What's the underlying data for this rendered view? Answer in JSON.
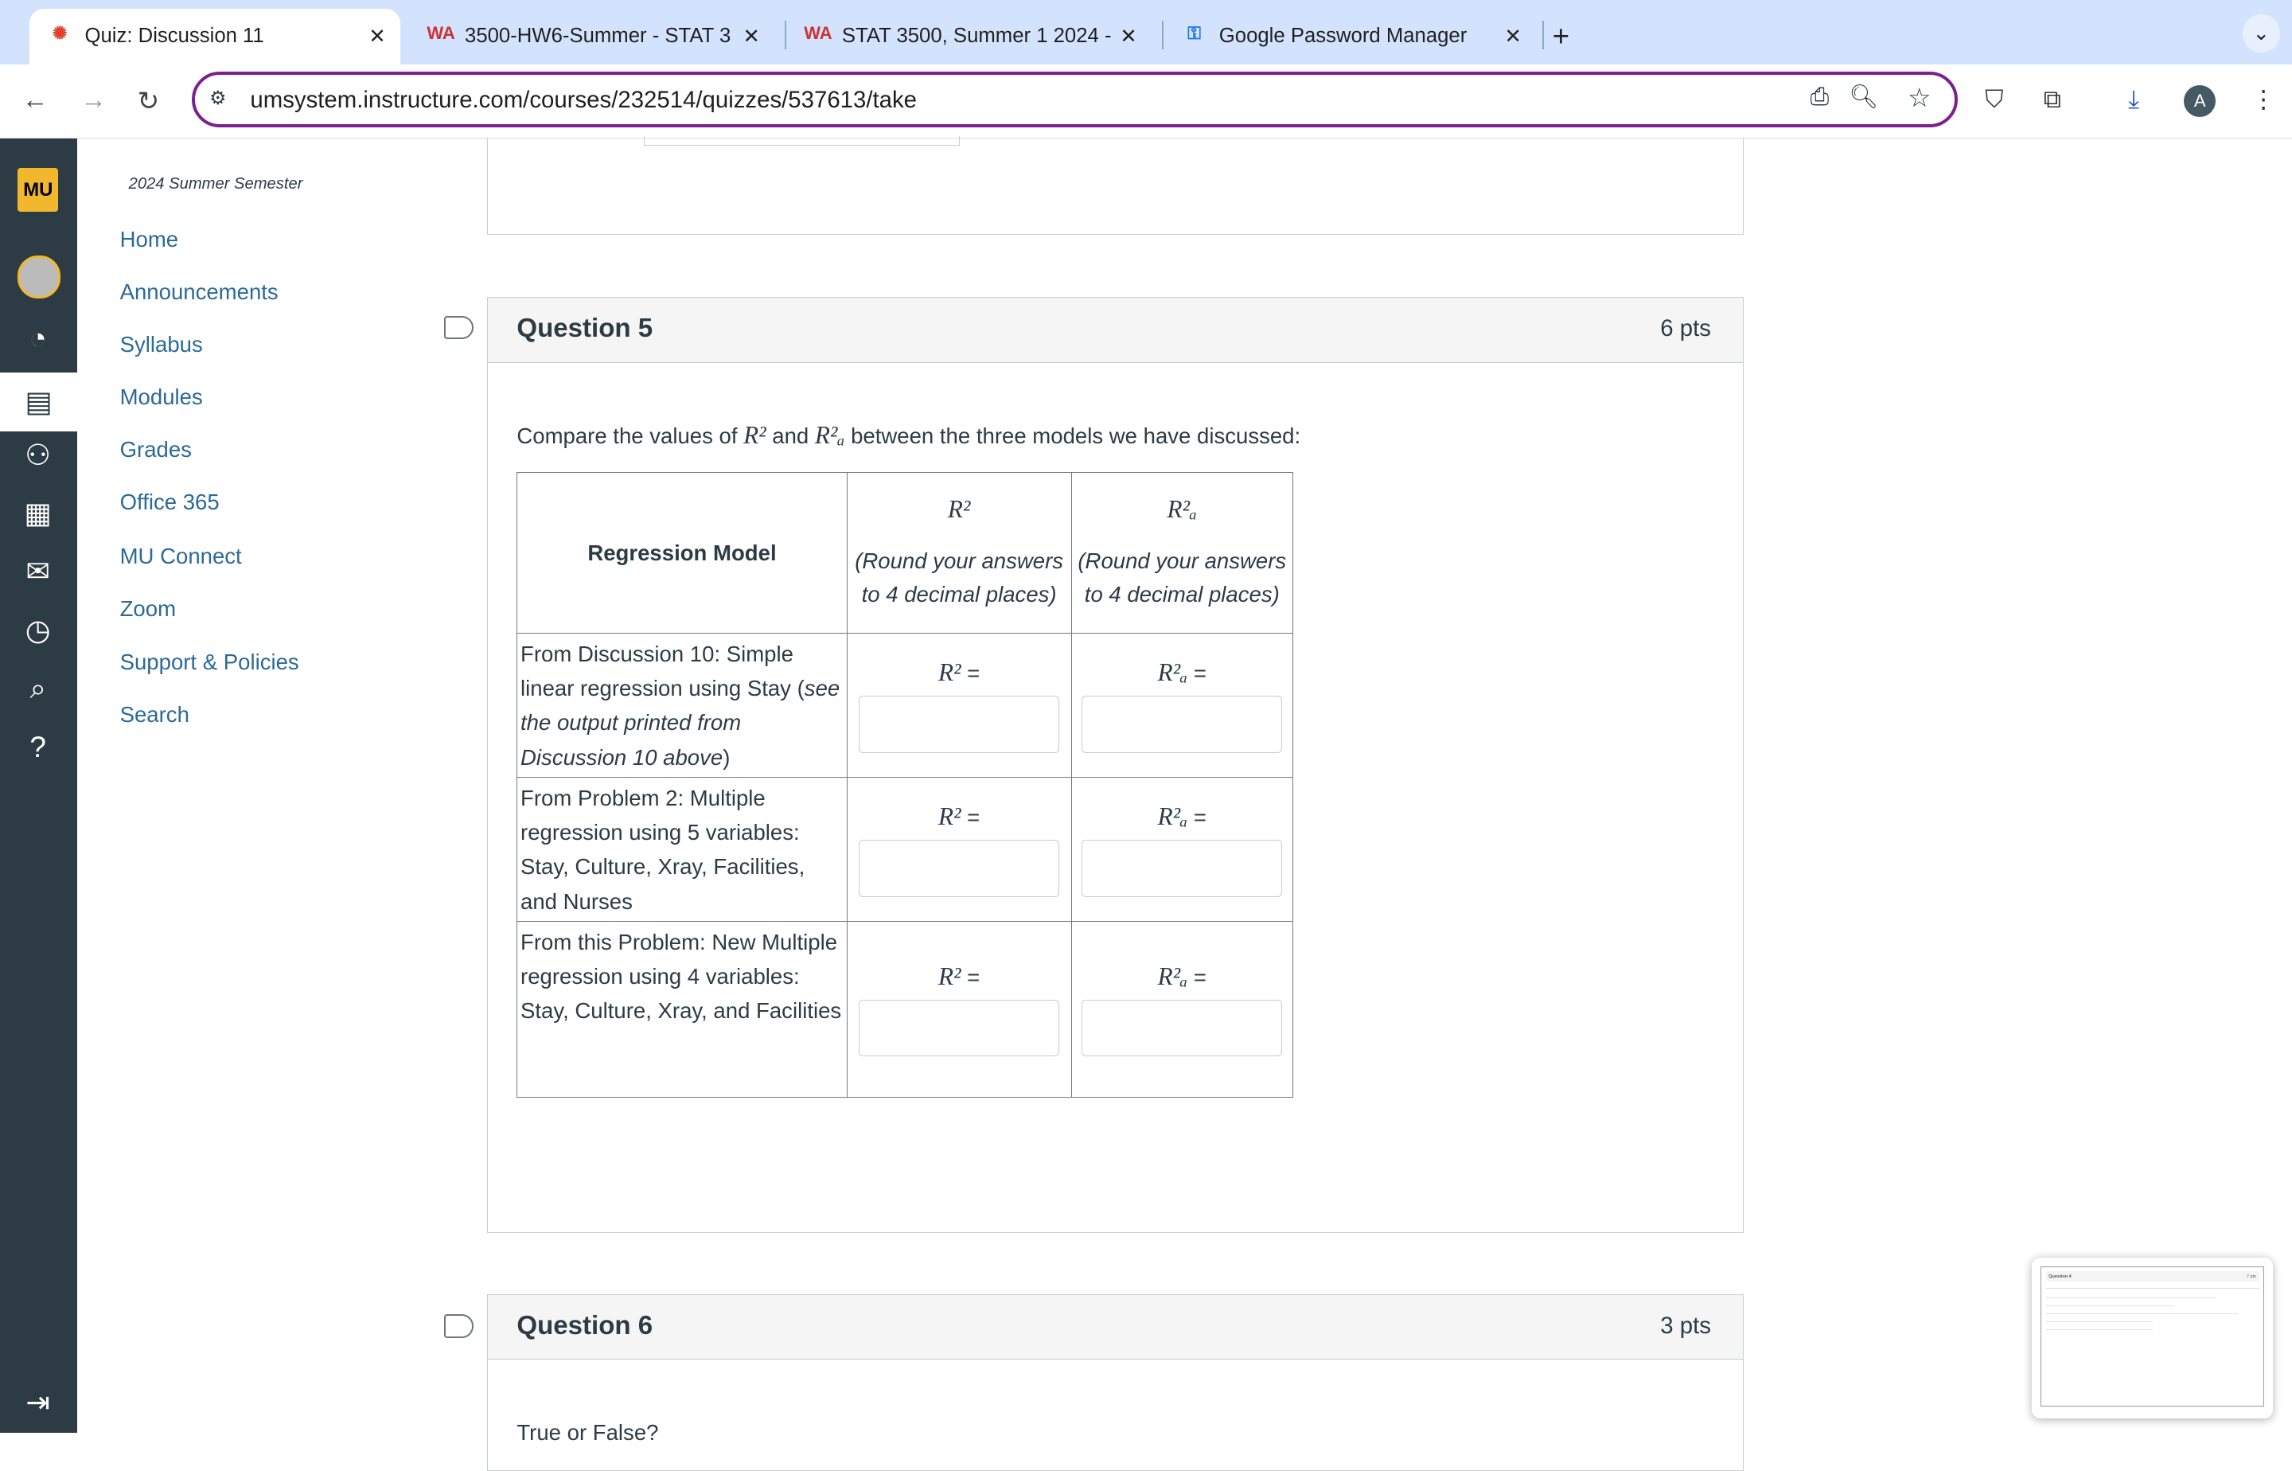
{
  "browser": {
    "tabs": [
      {
        "title": "Quiz: Discussion 11",
        "icon": "canvas-icon",
        "active": true
      },
      {
        "title": "3500-HW6-Summer - STAT 3",
        "icon": "webassign-icon"
      },
      {
        "title": "STAT 3500, Summer 1 2024 -",
        "icon": "webassign-icon"
      },
      {
        "title": "Google Password Manager",
        "icon": "key-icon"
      }
    ],
    "url": "umsystem.instructure.com/courses/232514/quizzes/537613/take",
    "profile_initial": "A"
  },
  "course_nav": {
    "semester": "2024 Summer Semester",
    "items": [
      "Home",
      "Announcements",
      "Syllabus",
      "Modules",
      "Grades",
      "Office 365",
      "MU Connect",
      "Zoom",
      "Support & Policies",
      "Search"
    ]
  },
  "logo_text": "MU",
  "question5": {
    "title": "Question 5",
    "points": "6 pts",
    "intro_a": "Compare the values of ",
    "intro_b": " and ",
    "intro_c": " between the three models we have discussed:",
    "col_model": "Regression Model",
    "col_note": "(Round your answers to 4 decimal places)",
    "r2": "R²",
    "ra2": "R²ₐ",
    "eq": " =",
    "rows": [
      {
        "label": "From Discussion 10: Simple linear regression using Stay (",
        "label_italic": "see the output printed from Discussion 10 above",
        "label_end": ")"
      },
      {
        "label": "From Problem 2:  Multiple regression using 5 variables: Stay, Culture, Xray, Facilities, and Nurses",
        "label_italic": "",
        "label_end": ""
      },
      {
        "label": "From this Problem:  New Multiple regression using 4 variables:\nStay, Culture, Xray, and Facilities",
        "label_italic": "",
        "label_end": ""
      }
    ]
  },
  "question6": {
    "title": "Question 6",
    "points": "3 pts",
    "text": "True or False?"
  },
  "thumbnail": {
    "title": "Question 4",
    "points": "7 pts"
  }
}
